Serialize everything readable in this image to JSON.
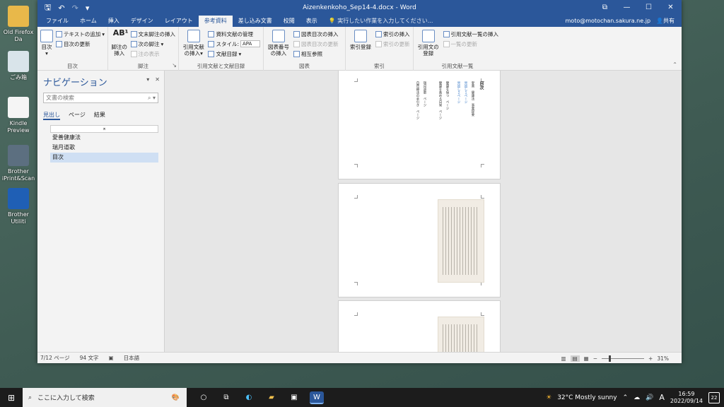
{
  "desktop": {
    "icons": [
      {
        "label": "Old Firefox Da",
        "icon": "folder-icon",
        "color": "#e8b84a"
      },
      {
        "label": "ごみ箱",
        "icon": "recycle-bin-icon",
        "color": "#d9e4ea"
      },
      {
        "label": "Kindle Preview",
        "icon": "kindle-preview-icon",
        "color": "#f5f5f5"
      },
      {
        "label": "Brother iPrint&Scan",
        "icon": "printer-icon",
        "color": "#5c6f80"
      },
      {
        "label": "Brother Utiliti",
        "icon": "brother-utilities-icon",
        "color": "#1f5fb5"
      }
    ]
  },
  "window": {
    "title": "Aizenkenkoho_Sep14-4.docx - Word",
    "qat": {
      "save": "🖫",
      "undo": "↶",
      "redo": "↷",
      "customize": "▾"
    },
    "controls": {
      "ribbon_options": "⧉",
      "minimize": "—",
      "maximize": "☐",
      "close": "✕"
    }
  },
  "tabs": [
    "ファイル",
    "ホーム",
    "挿入",
    "デザイン",
    "レイアウト",
    "参考資料",
    "差し込み文書",
    "校閲",
    "表示"
  ],
  "active_tab": "参考資料",
  "tell_me": "実行したい作業を入力してください...",
  "account": {
    "email": "moto@motochan.sakura.ne.jp",
    "share": "共有"
  },
  "ribbon": {
    "toc": {
      "label": "目次",
      "big": "目次",
      "add_text": "テキストの追加",
      "update": "目次の更新"
    },
    "footnotes": {
      "label": "脚注",
      "insert": "脚注の挿入",
      "endnote": "文末脚注の挿入",
      "next": "次の脚注",
      "show": "注の表示"
    },
    "citations": {
      "label": "引用文献と文献目録",
      "insert": "引用文献の挿入",
      "manage": "資料文献の管理",
      "style_label": "スタイル:",
      "style_value": "APA",
      "bibliography": "文献目録"
    },
    "captions": {
      "label": "図表",
      "insert": "図表番号の挿入",
      "table_of_figures": "図表目次の挿入",
      "update": "図表目次の更新",
      "cross_ref": "相互参照"
    },
    "index": {
      "label": "索引",
      "mark": "索引登録",
      "insert": "索引の挿入",
      "update": "索引の更新"
    },
    "authorities": {
      "label": "引用文献一覧",
      "mark": "引用文の登録",
      "insert": "引用文献一覧の挿入",
      "update": "一覧の更新"
    }
  },
  "nav": {
    "title": "ナビゲーション",
    "search_placeholder": "文書の検索",
    "tabs": [
      "見出し",
      "ページ",
      "結果"
    ],
    "tree_head": "⌅",
    "items": [
      "愛善健康法",
      "瑞月道歌",
      "目次"
    ],
    "selected": "目次"
  },
  "document": {
    "toc_lines": [
      "目次",
      "愛善　健康法　事業提要",
      "見出し１ページ",
      "見出し２ページ",
      "健康を保つ　ページ",
      "健康を進める日常　ページ",
      "瑞月道歌　ページ",
      "自然療法の手引き　ページ"
    ]
  },
  "status": {
    "page": "7/12 ページ",
    "words": "94 文字",
    "language": "日本語",
    "zoom": "31%"
  },
  "taskbar": {
    "search": "ここに入力して検索",
    "weather": "32°C  Mostly sunny",
    "ime": "A",
    "time": "16:59",
    "date": "2022/09/14",
    "notifications": "22"
  }
}
